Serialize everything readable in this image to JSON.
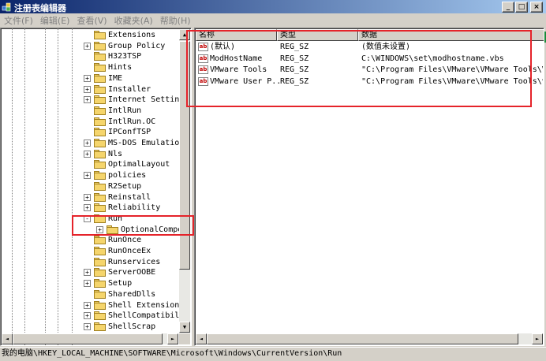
{
  "window": {
    "title": "注册表编辑器",
    "controls": {
      "minimize": "_",
      "maximize": "□",
      "close": "×"
    }
  },
  "menu": [
    "文件(F)",
    "编辑(E)",
    "查看(V)",
    "收藏夹(A)",
    "帮助(H)"
  ],
  "tree": {
    "items": [
      {
        "label": "Extensions",
        "expander": ""
      },
      {
        "label": "Group Policy",
        "expander": "+"
      },
      {
        "label": "H323TSP",
        "expander": ""
      },
      {
        "label": "Hints",
        "expander": ""
      },
      {
        "label": "IME",
        "expander": "+"
      },
      {
        "label": "Installer",
        "expander": "+"
      },
      {
        "label": "Internet Settings",
        "expander": "+"
      },
      {
        "label": "IntlRun",
        "expander": ""
      },
      {
        "label": "IntlRun.OC",
        "expander": ""
      },
      {
        "label": "IPConfTSP",
        "expander": ""
      },
      {
        "label": "MS-DOS Emulation",
        "expander": "+"
      },
      {
        "label": "Nls",
        "expander": "+"
      },
      {
        "label": "OptimalLayout",
        "expander": ""
      },
      {
        "label": "policies",
        "expander": "+"
      },
      {
        "label": "R2Setup",
        "expander": ""
      },
      {
        "label": "Reinstall",
        "expander": "+"
      },
      {
        "label": "Reliability",
        "expander": "+"
      },
      {
        "label": "Run",
        "expander": "-"
      },
      {
        "label": "OptionalCompon",
        "expander": "+",
        "child": true
      },
      {
        "label": "RunOnce",
        "expander": ""
      },
      {
        "label": "RunOnceEx",
        "expander": ""
      },
      {
        "label": "Runservices",
        "expander": ""
      },
      {
        "label": "ServerOOBE",
        "expander": "+"
      },
      {
        "label": "Setup",
        "expander": "+"
      },
      {
        "label": "SharedDlls",
        "expander": ""
      },
      {
        "label": "Shell Extensions",
        "expander": "+"
      },
      {
        "label": "ShellCompatibilit",
        "expander": "+"
      },
      {
        "label": "ShellScrap",
        "expander": "+"
      }
    ]
  },
  "list": {
    "headers": {
      "name": "名称",
      "type": "类型",
      "data": "数据"
    },
    "rows": [
      {
        "icon": "ab",
        "name": "(默认)",
        "type": "REG_SZ",
        "data": "(数值未设置)"
      },
      {
        "icon": "ab",
        "name": "ModHostName",
        "type": "REG_SZ",
        "data": "C:\\WINDOWS\\set\\modhostname.vbs"
      },
      {
        "icon": "ab",
        "name": "VMware Tools",
        "type": "REG_SZ",
        "data": "\"C:\\Program Files\\VMware\\VMware Tools\\VMwar"
      },
      {
        "icon": "ab",
        "name": "VMware User P...",
        "type": "REG_SZ",
        "data": "\"C:\\Program Files\\VMware\\VMware Tools\\vmtoo"
      }
    ]
  },
  "scroll": {
    "up": "▲",
    "down": "▼",
    "left": "◄",
    "right": "►"
  },
  "status": {
    "path": "我的电脑\\HKEY_LOCAL_MACHINE\\SOFTWARE\\Microsoft\\Windows\\CurrentVersion\\Run"
  },
  "colors": {
    "annotation": "#e5232a",
    "titlebar_start": "#0a246a",
    "titlebar_end": "#a6caf0"
  }
}
